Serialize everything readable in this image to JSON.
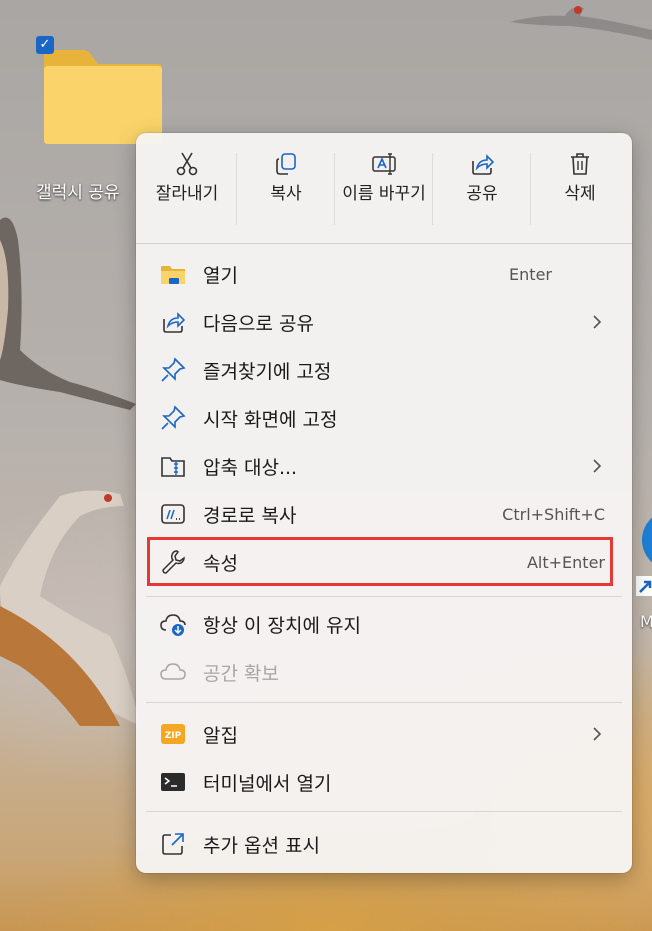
{
  "desktop": {
    "folder_label": "갤럭시 공유",
    "right_icon_label": "M"
  },
  "toolbar": {
    "cut": "잘라내기",
    "copy": "복사",
    "rename": "이름 바꾸기",
    "share": "공유",
    "delete": "삭제"
  },
  "menu": {
    "open": {
      "label": "열기",
      "shortcut": "Enter"
    },
    "share_with": {
      "label": "다음으로 공유"
    },
    "pin_quick_access": {
      "label": "즐겨찾기에 고정"
    },
    "pin_start": {
      "label": "시작 화면에 고정"
    },
    "compress": {
      "label": "압축 대상..."
    },
    "copy_path": {
      "label": "경로로 복사",
      "shortcut": "Ctrl+Shift+C"
    },
    "properties": {
      "label": "속성",
      "shortcut": "Alt+Enter"
    },
    "keep_on_device": {
      "label": "항상 이 장치에 유지"
    },
    "free_space": {
      "label": "공간 확보"
    },
    "alzip": {
      "label": "알집"
    },
    "open_terminal": {
      "label": "터미널에서 열기"
    },
    "more_options": {
      "label": "추가 옵션 표시"
    }
  },
  "colors": {
    "accent": "#1a66c6",
    "highlight_box": "#e53935",
    "folder_yellow": "#f7c948"
  }
}
